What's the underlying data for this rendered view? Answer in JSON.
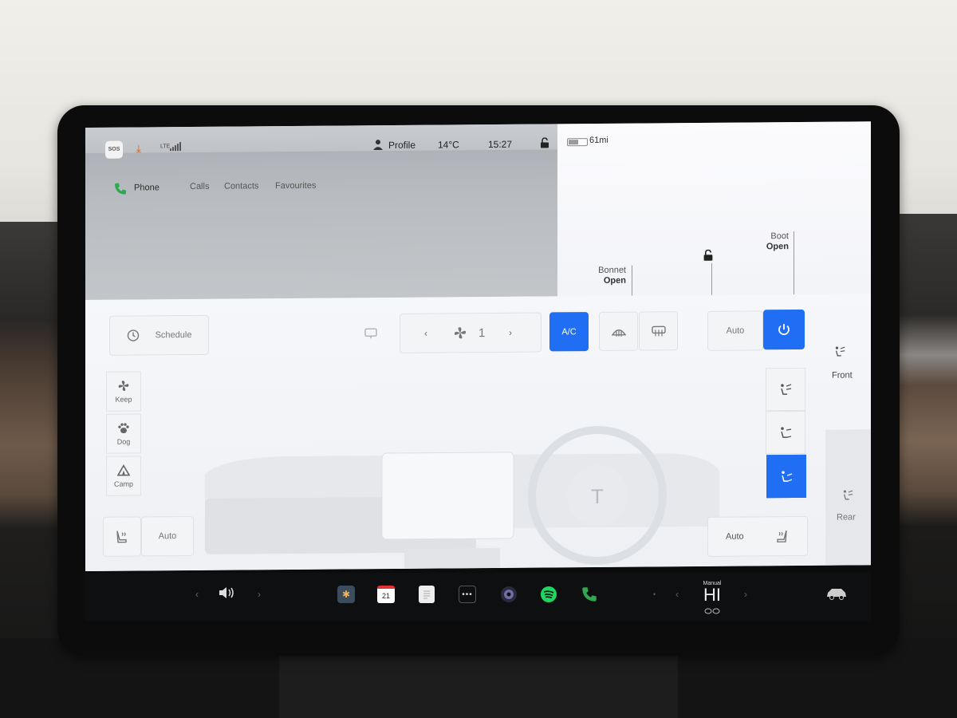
{
  "status_bar": {
    "sos": "SOS",
    "network": "LTE",
    "profile": "Profile",
    "temperature": "14°C",
    "time": "15:27"
  },
  "phone": {
    "label": "Phone",
    "tabs": [
      "Calls",
      "Contacts",
      "Favourites"
    ]
  },
  "car_status": {
    "range": "61mi",
    "bonnet": {
      "label": "Bonnet",
      "state": "Open"
    },
    "boot": {
      "label": "Boot",
      "state": "Open"
    }
  },
  "climate": {
    "schedule": "Schedule",
    "fan_speed": "1",
    "ac": "A/C",
    "auto": "Auto",
    "modes": [
      "Keep",
      "Dog",
      "Camp"
    ],
    "seat_left_auto": "Auto",
    "seat_right_auto": "Auto",
    "front": "Front",
    "rear": "Rear"
  },
  "taskbar": {
    "calendar_day": "21",
    "temp_mode": "Manual",
    "temp_value": "HI"
  },
  "colors": {
    "accent_blue": "#1f6ef3",
    "phone_green": "#2fa84f",
    "spotify_green": "#1ed760",
    "download_orange": "#d4631f"
  }
}
